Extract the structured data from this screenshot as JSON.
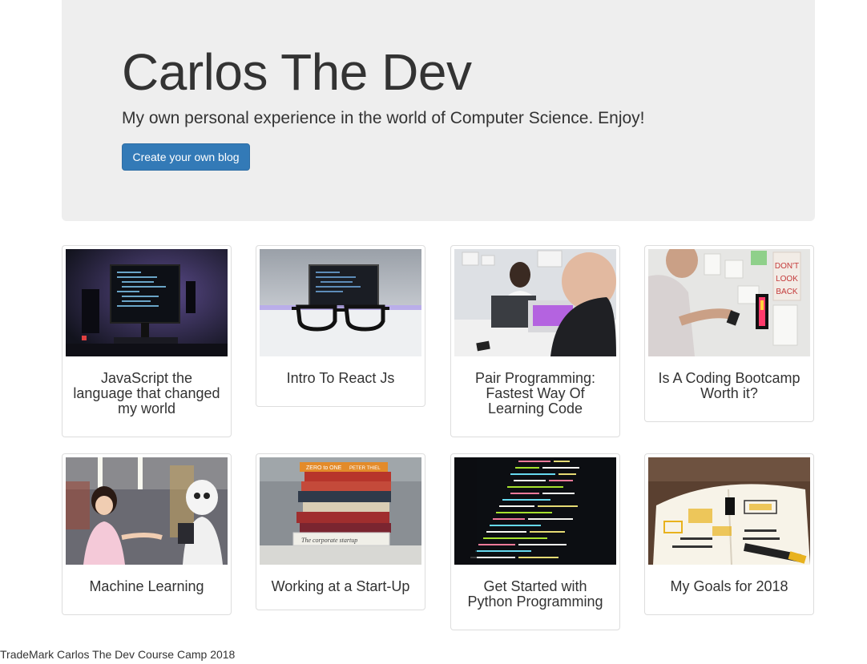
{
  "header": {
    "title": "Carlos The Dev",
    "tagline": "My own personal experience in the world of Computer Science. Enjoy!",
    "cta_label": "Create your own blog"
  },
  "cards": [
    {
      "title": "JavaScript the language that changed my world",
      "image": "monitor-with-code-photo"
    },
    {
      "title": "Intro To React Js",
      "image": "glasses-in-front-of-laptop-photo"
    },
    {
      "title": "Pair Programming: Fastest Way Of Learning Code",
      "image": "two-people-at-laptops-photo"
    },
    {
      "title": "Is A Coding Bootcamp Worth it?",
      "image": "man-with-phone-at-wall-photo"
    },
    {
      "title": "Machine Learning",
      "image": "girl-with-robot-photo"
    },
    {
      "title": "Working at a Start-Up",
      "image": "stack-of-books-photo"
    },
    {
      "title": "Get Started with Python Programming",
      "image": "code-on-screen-photo"
    },
    {
      "title": "My Goals for 2018",
      "image": "notebook-sketch-photo"
    }
  ],
  "photo_text": {
    "poster": "DON'T LOOK BACK",
    "book_zero_to_one": "ZERO to ONE",
    "book_peter_thiel": "PETER THIEL",
    "book_startup": "The corporate startup"
  },
  "footer": {
    "text": "TradeMark Carlos The Dev Course Camp 2018"
  }
}
